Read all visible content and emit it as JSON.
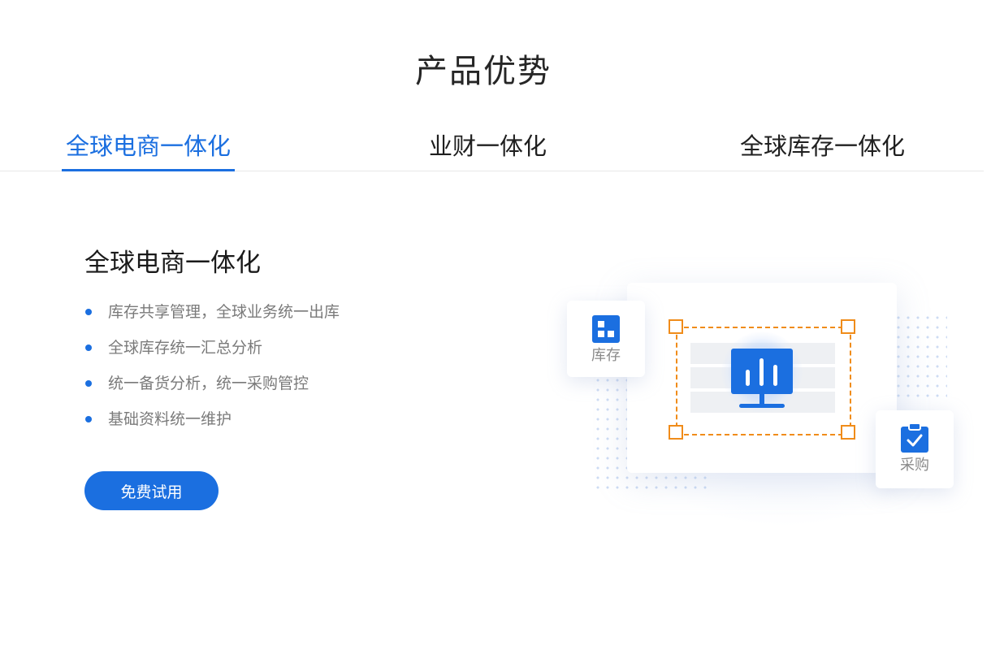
{
  "section": {
    "title": "产品优势"
  },
  "tabs": [
    {
      "label": "全球电商一体化",
      "active": true
    },
    {
      "label": "业财一体化",
      "active": false
    },
    {
      "label": "全球库存一体化",
      "active": false
    }
  ],
  "content": {
    "title": "全球电商一体化",
    "features": [
      "库存共享管理，全球业务统一出库",
      "全球库存统一汇总分析",
      "统一备货分析，统一采购管控",
      "基础资料统一维护"
    ],
    "cta_label": "免费试用"
  },
  "illustration": {
    "stock_label": "库存",
    "purchase_label": "采购",
    "icons": [
      "dashboard-grid-icon",
      "bar-chart-monitor-icon",
      "clipboard-check-icon"
    ]
  },
  "colors": {
    "accent": "#1b6fe0",
    "selection": "#f08c1a",
    "text_primary": "#1f1f1f",
    "text_secondary": "#7a7a7a"
  }
}
